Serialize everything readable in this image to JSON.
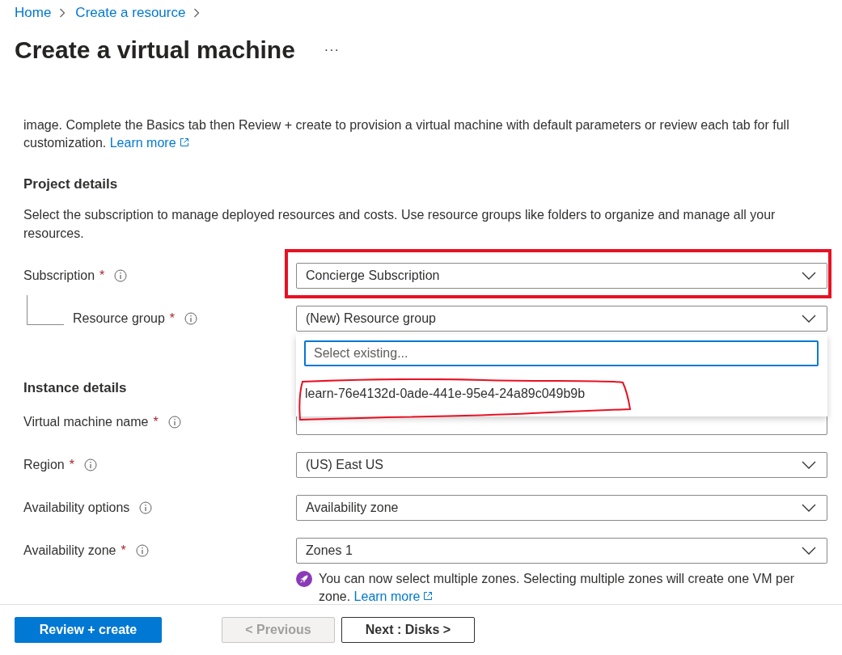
{
  "breadcrumb": [
    {
      "label": "Home"
    },
    {
      "label": "Create a resource"
    }
  ],
  "title": "Create a virtual machine",
  "more": "···",
  "intro": {
    "text": "image. Complete the Basics tab then Review + create to provision a virtual machine with default parameters or review each tab for full customization.",
    "link": "Learn more"
  },
  "required_mark": "*",
  "project_details": {
    "heading": "Project details",
    "description": "Select the subscription to manage deployed resources and costs. Use resource groups like folders to organize and manage all your resources.",
    "fields": [
      {
        "label": "Subscription",
        "required": true,
        "kind": "dropdown",
        "value": "Concierge Subscription",
        "expanded": false,
        "annotation": {
          "kind": "rectangle"
        },
        "children": [
          {
            "label": "Resource group",
            "required": true,
            "kind": "dropdown",
            "value": "(New) Resource group",
            "expanded": true,
            "search": {
              "placeholder": "Select existing..."
            },
            "options": [
              {
                "label": "learn-76e4132d-0ade-441e-95e4-24a89c049b9b",
                "selected": false,
                "annotation": {
                  "kind": "loop"
                }
              }
            ]
          }
        ]
      }
    ]
  },
  "instance_details": {
    "heading": "Instance details",
    "fields": [
      {
        "label": "Virtual machine name",
        "required": true,
        "kind": "text"
      },
      {
        "label": "Region",
        "required": true,
        "kind": "dropdown",
        "value": "(US) East US",
        "expanded": false
      },
      {
        "label": "Availability options",
        "required": false,
        "kind": "dropdown",
        "value": "Availability zone",
        "expanded": false
      },
      {
        "label": "Availability zone",
        "required": true,
        "kind": "dropdown",
        "value": "Zones 1",
        "expanded": false
      }
    ],
    "note": {
      "text": "You can now select multiple zones. Selecting multiple zones will create one VM per zone.",
      "link": "Learn more"
    }
  },
  "buttons": [
    {
      "label": "Review + create",
      "kind": "primary",
      "disabled": false
    },
    {
      "label": "< Previous",
      "kind": "secondary",
      "disabled": true
    },
    {
      "label": "Next : Disks >",
      "kind": "secondary",
      "disabled": false
    }
  ]
}
